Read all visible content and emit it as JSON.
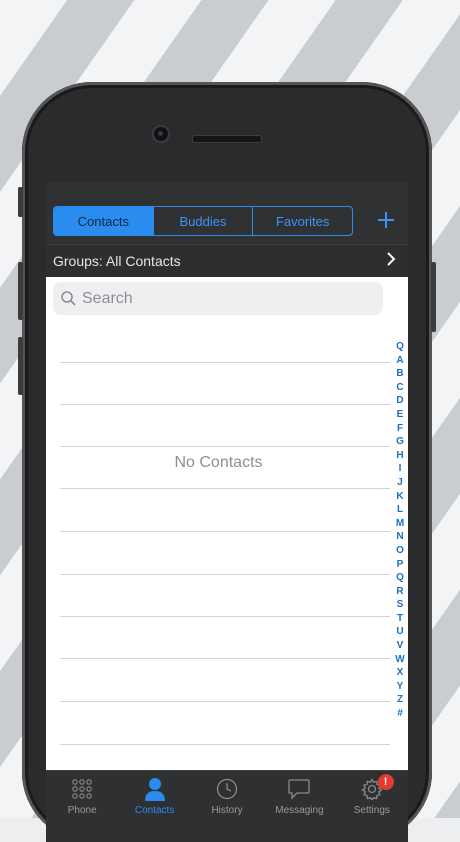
{
  "segments": [
    {
      "label": "Contacts",
      "active": true
    },
    {
      "label": "Buddies",
      "active": false
    },
    {
      "label": "Favorites",
      "active": false
    }
  ],
  "add_icon": "plus-icon",
  "groups": {
    "label": "Groups: All Contacts",
    "icon": "chevron-right-icon"
  },
  "search": {
    "placeholder": "Search",
    "value": ""
  },
  "empty_message": "No Contacts",
  "index_letters": [
    "Q",
    "A",
    "B",
    "C",
    "D",
    "E",
    "F",
    "G",
    "H",
    "I",
    "J",
    "K",
    "L",
    "M",
    "N",
    "O",
    "P",
    "Q",
    "R",
    "S",
    "T",
    "U",
    "V",
    "W",
    "X",
    "Y",
    "Z",
    "#"
  ],
  "tabs": [
    {
      "label": "Phone",
      "icon": "keypad-icon",
      "active": false
    },
    {
      "label": "Contacts",
      "icon": "person-icon",
      "active": true
    },
    {
      "label": "History",
      "icon": "clock-icon",
      "active": false
    },
    {
      "label": "Messaging",
      "icon": "chat-bubble-icon",
      "active": false
    },
    {
      "label": "Settings",
      "icon": "gear-icon",
      "active": false,
      "badge": "!"
    }
  ],
  "colors": {
    "accent": "#2b8cf0",
    "bar": "#303133",
    "badge": "#e63a2e",
    "index": "#1f6fc2"
  }
}
